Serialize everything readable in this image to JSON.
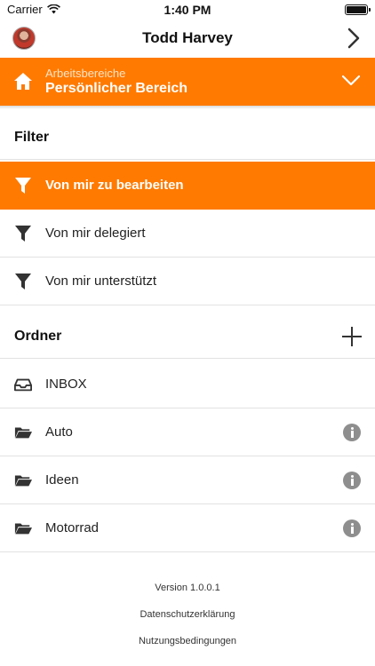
{
  "status_bar": {
    "carrier": "Carrier",
    "time": "1:40 PM",
    "battery_level": 1.0
  },
  "profile": {
    "name": "Todd Harvey",
    "avatar_icon": "user-avatar",
    "nav_icon": "chevron-right-icon"
  },
  "workspace": {
    "subtitle": "Arbeitsbereiche",
    "title": "Persönlicher Bereich",
    "icon": "home-icon",
    "toggle_icon": "chevron-down-icon",
    "color": "#ff7a00"
  },
  "filter": {
    "title": "Filter",
    "items": [
      {
        "label": "Von mir zu bearbeiten",
        "icon": "filter-icon",
        "active": true
      },
      {
        "label": "Von mir delegiert",
        "icon": "filter-icon",
        "active": false
      },
      {
        "label": "Von mir unterstützt",
        "icon": "filter-icon",
        "active": false
      }
    ]
  },
  "folders": {
    "title": "Ordner",
    "add_icon": "plus-icon",
    "items": [
      {
        "label": "INBOX",
        "icon": "inbox-icon",
        "info": false
      },
      {
        "label": "Auto",
        "icon": "folder-icon",
        "info": true
      },
      {
        "label": "Ideen",
        "icon": "folder-icon",
        "info": true
      },
      {
        "label": "Motorrad",
        "icon": "folder-icon",
        "info": true
      }
    ]
  },
  "footer": {
    "version": "Version 1.0.0.1",
    "privacy": "Datenschutzerklärung",
    "terms": "Nutzungsbedingungen"
  }
}
